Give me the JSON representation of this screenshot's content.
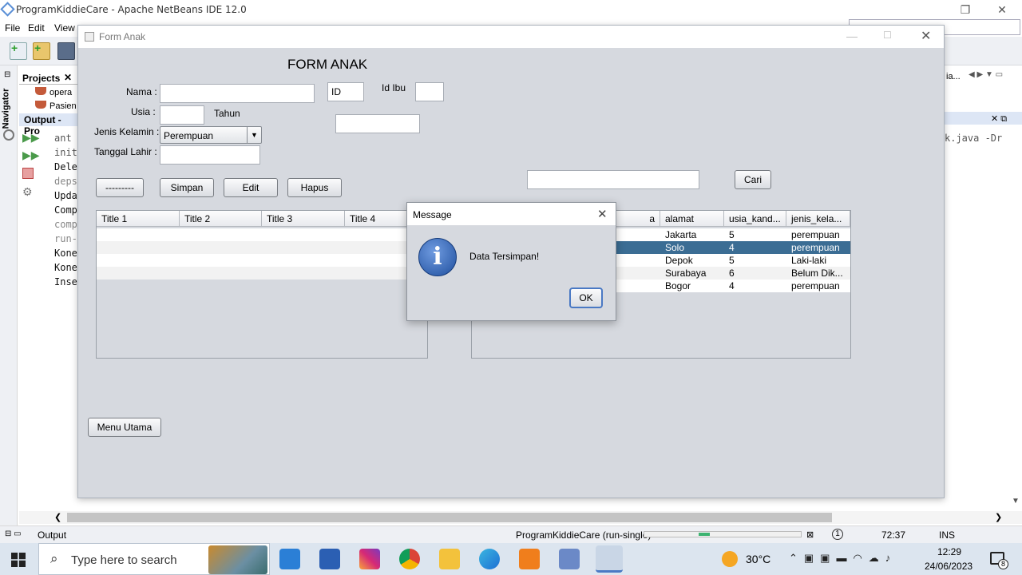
{
  "ide": {
    "title": "ProgramKiddieCare - Apache NetBeans IDE 12.0",
    "menu": [
      "File",
      "Edit",
      "View"
    ],
    "projects_tab": "Projects",
    "project_items": [
      "opera",
      "Pasien"
    ],
    "navigator_tab": "Navigator",
    "output_tab": "Output - Pro",
    "output_lines": [
      "ant",
      "init",
      "Dele",
      "deps",
      "Upda",
      "Comp",
      "comp",
      "run-",
      "Kone",
      "Kone",
      "Inse"
    ],
    "right_text_1": "ia...",
    "right_text_2": "k.java -Dr",
    "status": {
      "output_label": "Output",
      "task": "ProgramKiddieCare (run-single)",
      "notifications": "1",
      "position": "72:37",
      "mode": "INS"
    }
  },
  "form": {
    "window_title": "Form Anak",
    "heading": "FORM ANAK",
    "labels": {
      "nama": "Nama :",
      "usia": "Usia :",
      "tahun": "Tahun",
      "jenis_kelamin": "Jenis Kelamin :",
      "tanggal_lahir": "Tanggal Lahir :",
      "id_ibu": "Id Ibu"
    },
    "fields": {
      "nama": "",
      "id": "ID",
      "id_ibu": "",
      "usia": "",
      "extra": "",
      "tanggal_lahir": "",
      "search": ""
    },
    "gender_selected": "Perempuan",
    "buttons": {
      "blank": "---------",
      "simpan": "Simpan",
      "edit": "Edit",
      "hapus": "Hapus",
      "cari": "Cari",
      "menu_utama": "Menu Utama"
    },
    "left_table": {
      "columns": [
        "Title 1",
        "Title 2",
        "Title 3",
        "Title 4"
      ]
    },
    "right_table": {
      "columns": [
        "a",
        "alamat",
        "usia_kand...",
        "jenis_kela..."
      ],
      "rows": [
        [
          "",
          "Jakarta",
          "5",
          "perempuan"
        ],
        [
          "",
          "Solo",
          "4",
          "perempuan"
        ],
        [
          "",
          "Depok",
          "5",
          "Laki-laki"
        ],
        [
          "",
          "Surabaya",
          "6",
          "Belum Dik..."
        ],
        [
          "",
          "Bogor",
          "4",
          "perempuan"
        ]
      ],
      "selected_row": 1
    }
  },
  "dialog": {
    "title": "Message",
    "message": "Data Tersimpan!",
    "ok_label": "OK"
  },
  "taskbar": {
    "search_placeholder": "Type here to search",
    "weather": "30°C",
    "time": "12:29",
    "date": "24/06/2023",
    "notification_count": "8"
  },
  "colors": {
    "selection": "#3b6d94",
    "form_bg": "#d6d9df",
    "taskbar_bg": "#dce5ef"
  }
}
